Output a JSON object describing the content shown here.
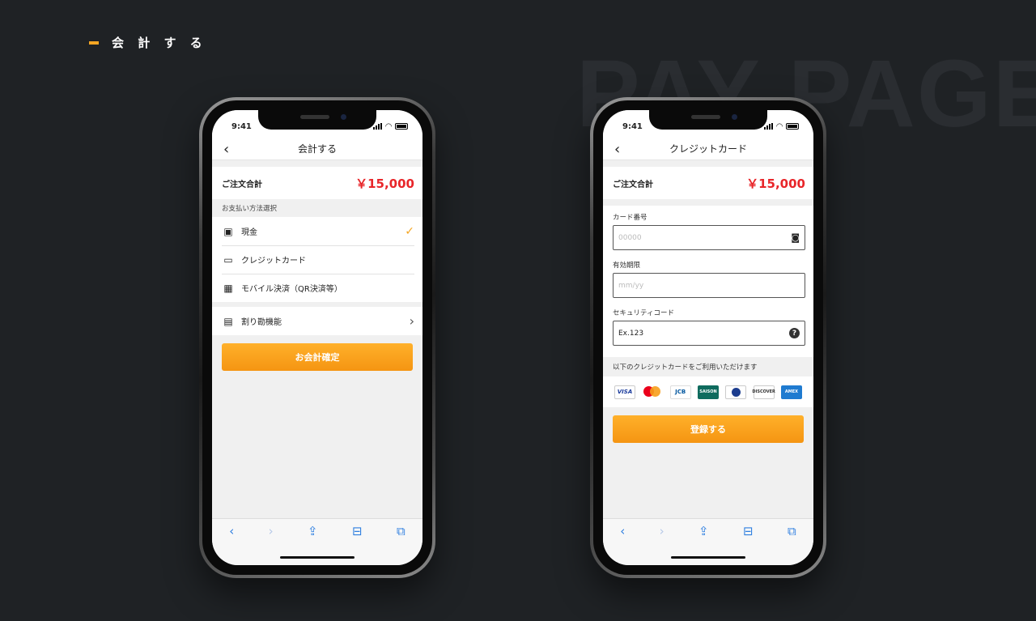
{
  "header": {
    "title": "会 計 す る",
    "bg_text": "PAY PAGE"
  },
  "colors": {
    "accent": "#f5a623",
    "price": "#e8262a",
    "link": "#2f7fe0"
  },
  "phone1": {
    "time": "9:41",
    "nav_title": "会計する",
    "total_label": "ご注文合計",
    "total_amount": "￥15,000",
    "section_label": "お支払い方法選択",
    "payment_methods": [
      {
        "label": "現金",
        "icon": "cash-icon",
        "selected": true
      },
      {
        "label": "クレジットカード",
        "icon": "credit-card-icon",
        "selected": false
      },
      {
        "label": "モバイル決済（QR決済等）",
        "icon": "qr-code-icon",
        "selected": false
      }
    ],
    "split_label": "割り勘機能",
    "confirm_button": "お会計確定"
  },
  "phone2": {
    "time": "9:41",
    "nav_title": "クレジットカード",
    "total_label": "ご注文合計",
    "total_amount": "￥15,000",
    "card_number_label": "カード番号",
    "card_number_placeholder": "00000",
    "expiry_label": "有効期限",
    "expiry_placeholder": "mm/yy",
    "cvc_label": "セキュリティコード",
    "cvc_value": "Ex.123",
    "cards_label": "以下のクレジットカードをご利用いただけます",
    "card_brands": [
      "VISA",
      "mastercard",
      "JCB",
      "SAISON CARD",
      "Diners Club",
      "DISCOVER",
      "AMERICAN EXPRESS"
    ],
    "submit_button": "登録する"
  },
  "toolbar_icons": [
    "back-arrow-icon",
    "forward-arrow-icon",
    "share-icon",
    "bookmarks-icon",
    "tabs-icon"
  ]
}
